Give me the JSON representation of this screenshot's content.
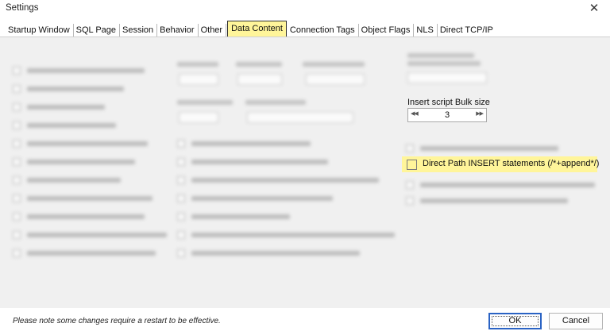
{
  "window": {
    "title": "Settings",
    "close_glyph": "✕"
  },
  "tabs": [
    {
      "label": "Startup Window"
    },
    {
      "label": "SQL Page"
    },
    {
      "label": "Session"
    },
    {
      "label": "Behavior"
    },
    {
      "label": "Other"
    },
    {
      "label": "Data Content",
      "active": true
    },
    {
      "label": "Connection Tags"
    },
    {
      "label": "Object Flags"
    },
    {
      "label": "NLS"
    },
    {
      "label": "Direct TCP/IP"
    }
  ],
  "insert_script": {
    "label": "Insert script Bulk size",
    "value": "3",
    "decrement_glyph": "◀◀",
    "increment_glyph": "▶▶"
  },
  "highlighted_option": {
    "label": "Direct Path INSERT statements (/*+append*/)",
    "checked": false
  },
  "footer": {
    "note": "Please note some changes require a restart to be effective.",
    "ok_label": "OK",
    "cancel_label": "Cancel"
  },
  "colors": {
    "highlight": "#fff59a",
    "dialog_bg": "#f0f0f0",
    "ok_border": "#2a63c4"
  }
}
